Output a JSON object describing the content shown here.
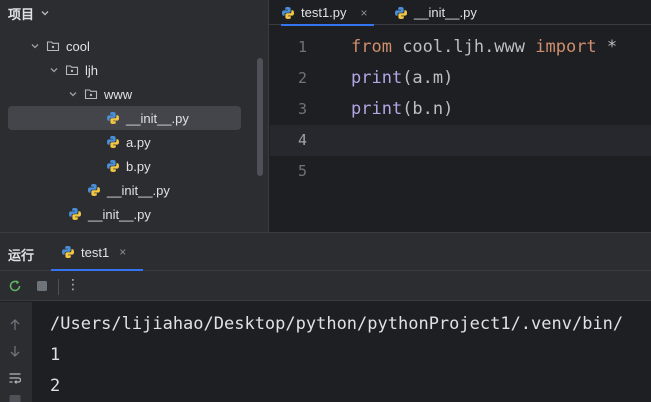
{
  "project_panel": {
    "title": "项目",
    "tree": [
      {
        "label": "cool",
        "kind": "folder",
        "depth": 0,
        "expanded": true
      },
      {
        "label": "ljh",
        "kind": "folder",
        "depth": 1,
        "expanded": true
      },
      {
        "label": "www",
        "kind": "folder",
        "depth": 2,
        "expanded": true
      },
      {
        "label": "__init__.py",
        "kind": "python-file",
        "depth": 3,
        "selected": true
      },
      {
        "label": "a.py",
        "kind": "python-file",
        "depth": 3
      },
      {
        "label": "b.py",
        "kind": "python-file",
        "depth": 3
      },
      {
        "label": "__init__.py",
        "kind": "python-file",
        "depth": 2
      },
      {
        "label": "__init__.py",
        "kind": "python-file",
        "depth": 1
      }
    ]
  },
  "editor": {
    "tabs": [
      {
        "label": "test1.py",
        "active": true,
        "close": "×"
      },
      {
        "label": "__init__.py",
        "active": false
      }
    ],
    "line_numbers": [
      "1",
      "2",
      "3",
      "4",
      "5"
    ],
    "current_line": "4",
    "code": {
      "line1": {
        "kw1": "from",
        "mid": " cool.ljh.www ",
        "kw2": "import",
        "rest": " *"
      },
      "line2": {
        "fn": "print",
        "rest": "(a.m)"
      },
      "line3": {
        "fn": "print",
        "rest": "(b.n)"
      }
    }
  },
  "run": {
    "title": "运行",
    "tab": {
      "label": "test1",
      "close": "×"
    },
    "toolbar": [
      "rerun-icon",
      "stop-icon",
      "more-options-icon"
    ],
    "more": "⋮",
    "console_lines": [
      "/Users/lijiahao/Desktop/python/pythonProject1/.venv/bin/",
      "1",
      "2"
    ]
  },
  "colors": {
    "accent": "#3574f0",
    "keyword": "#cf8e6d",
    "function": "#b3a6e6",
    "python_blue": "#4a8fd8",
    "python_yellow": "#f2c744"
  }
}
